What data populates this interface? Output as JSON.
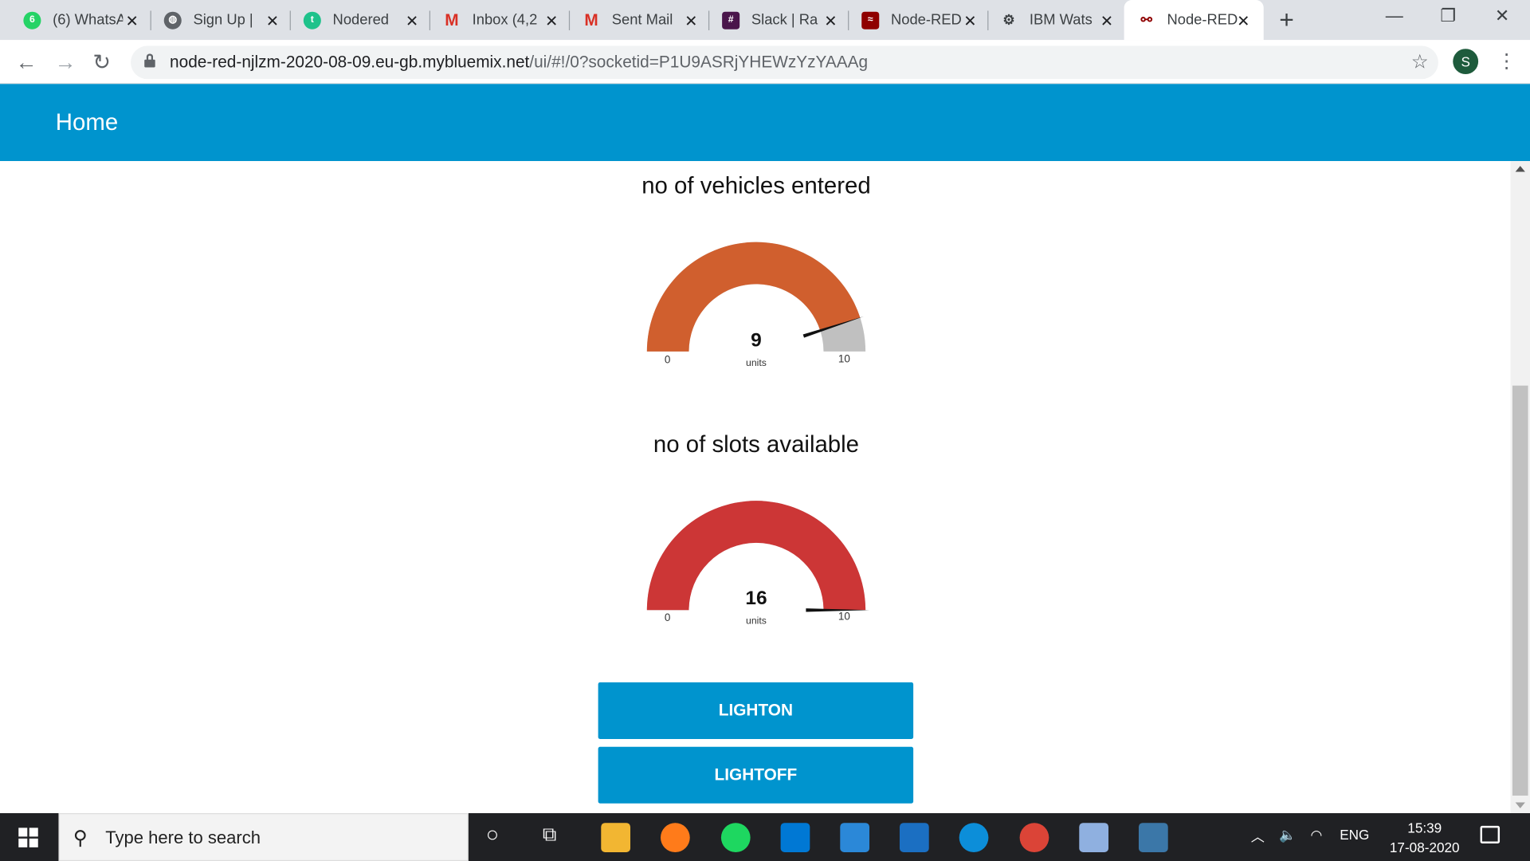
{
  "browser": {
    "tabs": [
      {
        "label": "(6) WhatsApp",
        "icon": "whatsapp-icon",
        "color": "#25d366"
      },
      {
        "label": "Sign Up | ",
        "icon": "globe-icon",
        "color": "#5f6368"
      },
      {
        "label": "Nodered",
        "icon": "tinkercad-icon",
        "color": "#1ec28b"
      },
      {
        "label": "Inbox (4,2",
        "icon": "gmail-icon",
        "color": "#d93025"
      },
      {
        "label": "Sent Mail",
        "icon": "gmail-icon",
        "color": "#d93025"
      },
      {
        "label": "Slack | Ra",
        "icon": "slack-icon",
        "color": "#4a154b"
      },
      {
        "label": "Node-RED",
        "icon": "node-red-icon",
        "color": "#8f0000"
      },
      {
        "label": "IBM Wats",
        "icon": "ibm-watson-icon",
        "color": "#3c4043"
      },
      {
        "label": "Node-RED",
        "icon": "node-red-icon",
        "color": "#8f0000",
        "active": true
      }
    ],
    "url_host": "node-red-njlzm-2020-08-09.eu-gb.mybluemix.net",
    "url_path": "/ui/#!/0?socketid=P1U9ASRjYHEWzYzYAAAg",
    "profile_initial": "S"
  },
  "dashboard": {
    "title": "Home",
    "accent": "#0094ce",
    "gauges": [
      {
        "title": "no of vehicles entered",
        "value": "9",
        "units": "units",
        "min": "0",
        "max": "10",
        "fraction": 0.9,
        "color": "#d05f2e"
      },
      {
        "title": "no of slots available",
        "value": "16",
        "units": "units",
        "min": "0",
        "max": "10",
        "fraction": 1.0,
        "color": "#cc3636"
      }
    ],
    "buttons": [
      {
        "label": "LIGHTON"
      },
      {
        "label": "LIGHTOFF"
      }
    ]
  },
  "taskbar": {
    "search_placeholder": "Type here to search",
    "language": "ENG",
    "time": "15:39",
    "date": "17-08-2020"
  }
}
